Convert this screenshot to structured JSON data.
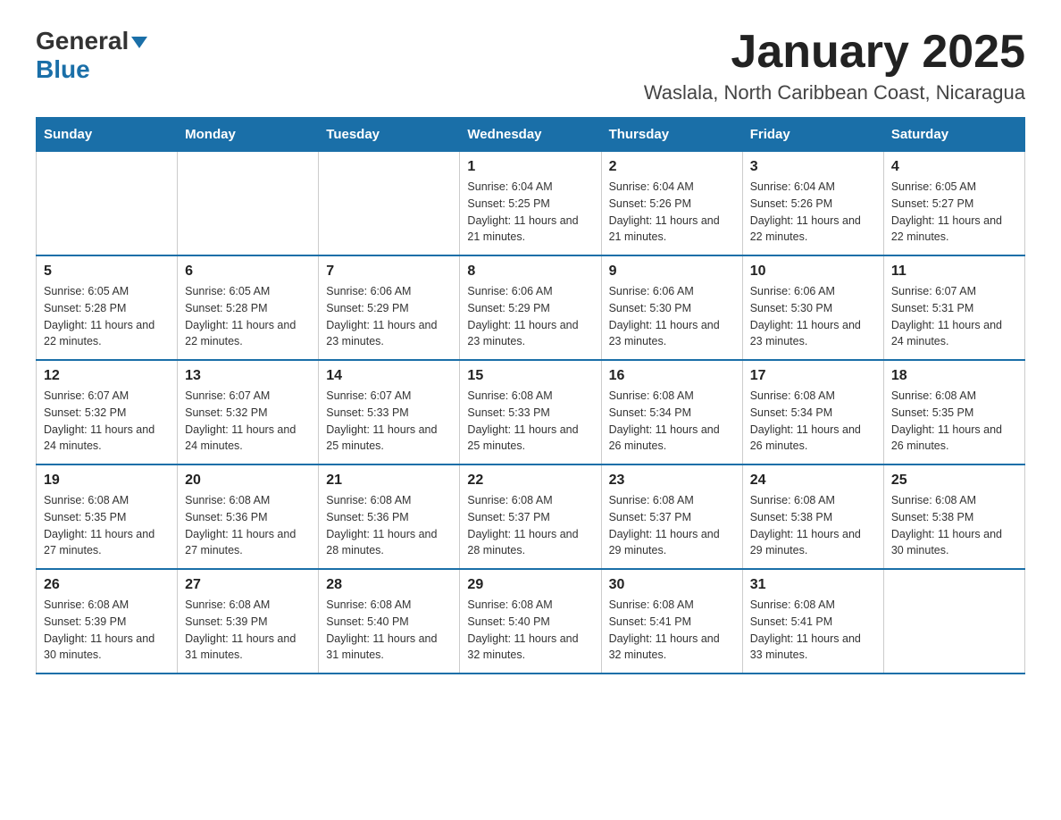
{
  "header": {
    "logo_general": "General",
    "logo_blue": "Blue",
    "title": "January 2025",
    "subtitle": "Waslala, North Caribbean Coast, Nicaragua"
  },
  "weekdays": [
    "Sunday",
    "Monday",
    "Tuesday",
    "Wednesday",
    "Thursday",
    "Friday",
    "Saturday"
  ],
  "weeks": [
    [
      {
        "day": "",
        "info": ""
      },
      {
        "day": "",
        "info": ""
      },
      {
        "day": "",
        "info": ""
      },
      {
        "day": "1",
        "info": "Sunrise: 6:04 AM\nSunset: 5:25 PM\nDaylight: 11 hours and 21 minutes."
      },
      {
        "day": "2",
        "info": "Sunrise: 6:04 AM\nSunset: 5:26 PM\nDaylight: 11 hours and 21 minutes."
      },
      {
        "day": "3",
        "info": "Sunrise: 6:04 AM\nSunset: 5:26 PM\nDaylight: 11 hours and 22 minutes."
      },
      {
        "day": "4",
        "info": "Sunrise: 6:05 AM\nSunset: 5:27 PM\nDaylight: 11 hours and 22 minutes."
      }
    ],
    [
      {
        "day": "5",
        "info": "Sunrise: 6:05 AM\nSunset: 5:28 PM\nDaylight: 11 hours and 22 minutes."
      },
      {
        "day": "6",
        "info": "Sunrise: 6:05 AM\nSunset: 5:28 PM\nDaylight: 11 hours and 22 minutes."
      },
      {
        "day": "7",
        "info": "Sunrise: 6:06 AM\nSunset: 5:29 PM\nDaylight: 11 hours and 23 minutes."
      },
      {
        "day": "8",
        "info": "Sunrise: 6:06 AM\nSunset: 5:29 PM\nDaylight: 11 hours and 23 minutes."
      },
      {
        "day": "9",
        "info": "Sunrise: 6:06 AM\nSunset: 5:30 PM\nDaylight: 11 hours and 23 minutes."
      },
      {
        "day": "10",
        "info": "Sunrise: 6:06 AM\nSunset: 5:30 PM\nDaylight: 11 hours and 23 minutes."
      },
      {
        "day": "11",
        "info": "Sunrise: 6:07 AM\nSunset: 5:31 PM\nDaylight: 11 hours and 24 minutes."
      }
    ],
    [
      {
        "day": "12",
        "info": "Sunrise: 6:07 AM\nSunset: 5:32 PM\nDaylight: 11 hours and 24 minutes."
      },
      {
        "day": "13",
        "info": "Sunrise: 6:07 AM\nSunset: 5:32 PM\nDaylight: 11 hours and 24 minutes."
      },
      {
        "day": "14",
        "info": "Sunrise: 6:07 AM\nSunset: 5:33 PM\nDaylight: 11 hours and 25 minutes."
      },
      {
        "day": "15",
        "info": "Sunrise: 6:08 AM\nSunset: 5:33 PM\nDaylight: 11 hours and 25 minutes."
      },
      {
        "day": "16",
        "info": "Sunrise: 6:08 AM\nSunset: 5:34 PM\nDaylight: 11 hours and 26 minutes."
      },
      {
        "day": "17",
        "info": "Sunrise: 6:08 AM\nSunset: 5:34 PM\nDaylight: 11 hours and 26 minutes."
      },
      {
        "day": "18",
        "info": "Sunrise: 6:08 AM\nSunset: 5:35 PM\nDaylight: 11 hours and 26 minutes."
      }
    ],
    [
      {
        "day": "19",
        "info": "Sunrise: 6:08 AM\nSunset: 5:35 PM\nDaylight: 11 hours and 27 minutes."
      },
      {
        "day": "20",
        "info": "Sunrise: 6:08 AM\nSunset: 5:36 PM\nDaylight: 11 hours and 27 minutes."
      },
      {
        "day": "21",
        "info": "Sunrise: 6:08 AM\nSunset: 5:36 PM\nDaylight: 11 hours and 28 minutes."
      },
      {
        "day": "22",
        "info": "Sunrise: 6:08 AM\nSunset: 5:37 PM\nDaylight: 11 hours and 28 minutes."
      },
      {
        "day": "23",
        "info": "Sunrise: 6:08 AM\nSunset: 5:37 PM\nDaylight: 11 hours and 29 minutes."
      },
      {
        "day": "24",
        "info": "Sunrise: 6:08 AM\nSunset: 5:38 PM\nDaylight: 11 hours and 29 minutes."
      },
      {
        "day": "25",
        "info": "Sunrise: 6:08 AM\nSunset: 5:38 PM\nDaylight: 11 hours and 30 minutes."
      }
    ],
    [
      {
        "day": "26",
        "info": "Sunrise: 6:08 AM\nSunset: 5:39 PM\nDaylight: 11 hours and 30 minutes."
      },
      {
        "day": "27",
        "info": "Sunrise: 6:08 AM\nSunset: 5:39 PM\nDaylight: 11 hours and 31 minutes."
      },
      {
        "day": "28",
        "info": "Sunrise: 6:08 AM\nSunset: 5:40 PM\nDaylight: 11 hours and 31 minutes."
      },
      {
        "day": "29",
        "info": "Sunrise: 6:08 AM\nSunset: 5:40 PM\nDaylight: 11 hours and 32 minutes."
      },
      {
        "day": "30",
        "info": "Sunrise: 6:08 AM\nSunset: 5:41 PM\nDaylight: 11 hours and 32 minutes."
      },
      {
        "day": "31",
        "info": "Sunrise: 6:08 AM\nSunset: 5:41 PM\nDaylight: 11 hours and 33 minutes."
      },
      {
        "day": "",
        "info": ""
      }
    ]
  ]
}
